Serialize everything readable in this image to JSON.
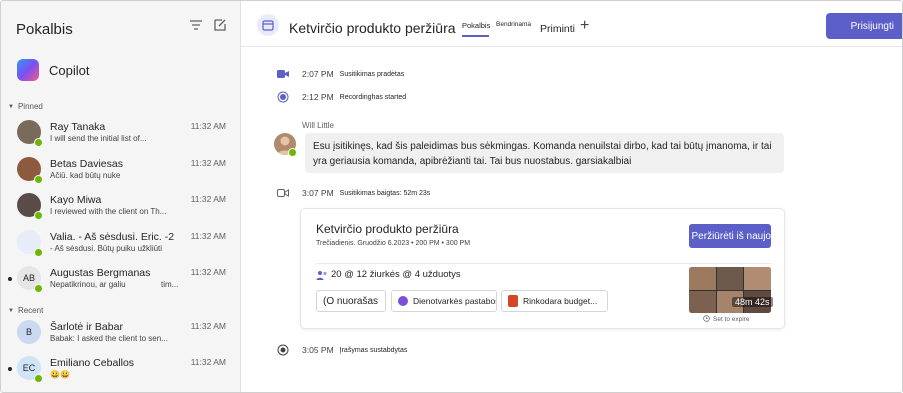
{
  "sidebar": {
    "title": "Pokalbis",
    "copilot_label": "Copilot",
    "pinned_label": "Pinned",
    "recent_label": "Recent",
    "pinned": [
      {
        "name": "Ray Tanaka",
        "preview": "I will send the initial list of...",
        "time": "11:32 AM",
        "avatar_color": "#7a6a5a",
        "initials": "",
        "status": "available",
        "bullet": false
      },
      {
        "name": "Betas Daviesas",
        "preview": "Ačiū. kad būtų nuke",
        "time": "11:32 AM",
        "avatar_color": "#8c5a3c",
        "initials": "",
        "status": "available",
        "bullet": false
      },
      {
        "name": "Kayo Miwa",
        "preview": "I reviewed with the client on Th...",
        "time": "11:32 AM",
        "avatar_color": "#5a4a48",
        "initials": "",
        "status": "available",
        "bullet": false
      },
      {
        "name": "Valia. - Aš sėsdusi. Eric. -2",
        "preview": "- Aš sėsdusi. Būtų puiku užkliūti",
        "time": "11:32 AM",
        "avatar_color": "#e8ecf8",
        "initials": "",
        "status": "available",
        "bullet": false
      },
      {
        "name": "Augustas Bergmanas",
        "preview": "Nepatikrinou, ar galiu",
        "preview_end": "tim...",
        "time": "11:32 AM",
        "avatar_color": "#e6e6e6",
        "initials": "AB",
        "status": "available",
        "bullet": true
      }
    ],
    "recent": [
      {
        "name": "Šarlotė ir Babar",
        "preview": "Babak: I asked the client to sen...",
        "time": "11:32 AM",
        "avatar_color": "#c9d9f0",
        "initials": "B",
        "status": "",
        "bullet": false
      },
      {
        "name": "Emiliano Ceballos",
        "preview": "😀😀",
        "time": "11:32 AM",
        "avatar_color": "#cfe4f7",
        "initials": "EC",
        "status": "available",
        "bullet": true
      }
    ]
  },
  "header": {
    "title": "Ketvirčio produkto peržiūra",
    "tabs": [
      {
        "label": "Pokalbis",
        "active": true
      },
      {
        "label": "Bendrinama",
        "active": false
      },
      {
        "label": "Priminti",
        "active": false
      }
    ],
    "join_label": "Prisijungti"
  },
  "timeline": {
    "events": [
      {
        "time": "2:07 PM",
        "text": "Susitikimas pradėtas",
        "icon": "video-icon"
      },
      {
        "time": "2:12 PM",
        "text": "Recordinghas started",
        "icon": "record-icon"
      }
    ],
    "message": {
      "sender": "Will Little",
      "text": "Esu įsitikinęs, kad šis paleidimas bus sėkmingas. Komanda nenuilstai dirbo, kad tai būtų įmanoma, ir tai yra geriausia komanda, apibrėžianti tai. Tai bus nuostabus. garsiakalbiai"
    },
    "ended_event": {
      "time": "3:07 PM",
      "text": "Susitikimas baigtas: 52m 23s"
    },
    "recording_stopped": {
      "time": "3:05 PM",
      "text": "Įrašymas sustabdytas"
    }
  },
  "meeting_card": {
    "title": "Ketvirčio produkto peržiūra",
    "subtitle": "Trečiadienis. Gruodžio 6.2023 • 200 PM • 300 PM",
    "view_button": "Peržiūrėti iš naujo",
    "stats": "20 @ 12 žiurkės @ 4 užduotys",
    "chips": [
      "(O nuorašas",
      "Dienotvarkės pastabos",
      "Rinkodara budget..."
    ],
    "duration": "48m 42s",
    "expire": "Set to expire"
  },
  "colors": {
    "accent": "#5b5fc7",
    "presence": "#6bb700"
  }
}
